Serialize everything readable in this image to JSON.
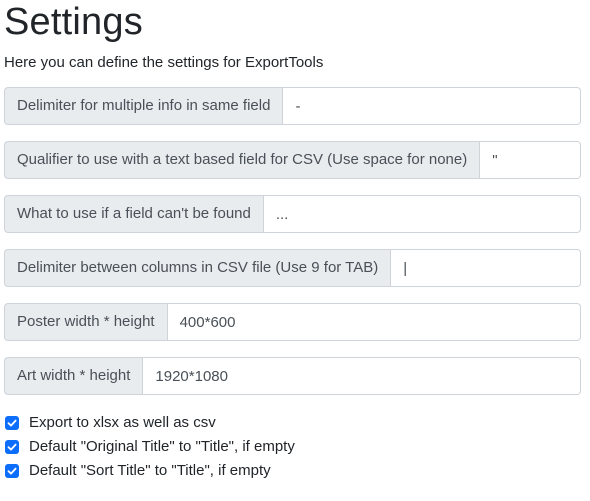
{
  "page": {
    "title": "Settings",
    "subtitle": "Here you can define the settings for ExportTools"
  },
  "fields": [
    {
      "label": "Delimiter for multiple info in same field",
      "value": "-"
    },
    {
      "label": "Qualifier to use with a text based field for CSV (Use space for none)",
      "value": "\""
    },
    {
      "label": "What to use if a field can't be found",
      "value": "..."
    },
    {
      "label": "Delimiter between columns in CSV file (Use 9 for TAB)",
      "value": "|"
    },
    {
      "label": "Poster width * height",
      "value": "400*600"
    },
    {
      "label": "Art width * height",
      "value": "1920*1080"
    }
  ],
  "checkboxes": [
    {
      "label": "Export to xlsx as well as csv",
      "checked": true
    },
    {
      "label": "Default \"Original Title\" to \"Title\", if empty",
      "checked": true
    },
    {
      "label": "Default \"Sort Title\" to \"Title\", if empty",
      "checked": true
    }
  ],
  "colors": {
    "accent": "#0d6efd",
    "label_bg": "#e9ecef",
    "border": "#ced4da"
  }
}
